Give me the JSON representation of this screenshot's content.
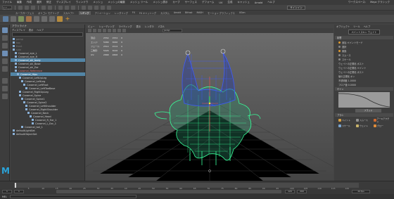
{
  "app": {
    "title": "Maya",
    "workspace_label": "ワークスペース:",
    "workspace_value": "Maya クラシック"
  },
  "menubar": [
    "ファイル",
    "編集",
    "作成",
    "選択",
    "修正",
    "ディスプレイ",
    "ウィンドウ",
    "メッシュ",
    "メッシュの編集",
    "メッシュ ツール",
    "メッシュ表示",
    "カーブ",
    "サーフェス",
    "デフォーム",
    "UV",
    "生成",
    "キャッシュ",
    "Arnold",
    "ヘルプ"
  ],
  "status": {
    "mode": "モデリング",
    "signin": "サインイン"
  },
  "shelf_tabs": [
    "カーブ/サーフェス",
    "ポリゴン モデリング",
    "スカルプト",
    "リギング",
    "アニメーション",
    "レンダリング",
    "FX",
    "FX キャッシング",
    "カスタム",
    "Arnold",
    "Bifrost",
    "MASH",
    "モーション グラフィックス",
    "XGen"
  ],
  "shelf_active": "リギング",
  "outliner": {
    "title": "アウトライナ",
    "menu": [
      "ディスプレイ",
      "表示",
      "ヘルプ"
    ],
    "items": [
      {
        "label": "persp",
        "state": "dim"
      },
      {
        "label": "top",
        "state": "dim"
      },
      {
        "label": "front",
        "state": "dim"
      },
      {
        "label": "side",
        "state": "dim"
      },
      {
        "label": "Caramel_eye_L",
        "state": "normal"
      },
      {
        "label": "Caramel_eye_R",
        "state": "normal"
      },
      {
        "label": "Caramel_skl_body",
        "state": "hl"
      },
      {
        "label": "Caramel_skl_Base",
        "state": "normal"
      },
      {
        "label": "Caramel_skl_Ear",
        "state": "normal"
      },
      {
        "label": "Caramel_Reference",
        "state": "red"
      },
      {
        "label": "Caramel_Hips",
        "state": "hl"
      },
      {
        "label": "Caramel_LeftUpLeg",
        "state": "normal"
      },
      {
        "label": "Caramel_LeftLeg",
        "state": "normal"
      },
      {
        "label": "Caramel_LeftFoot",
        "state": "normal"
      },
      {
        "label": "Caramel_LeftToeBase",
        "state": "normal"
      },
      {
        "label": "Caramel_RightUpLeg",
        "state": "normal"
      },
      {
        "label": "Caramel_Spine",
        "state": "normal"
      },
      {
        "label": "Caramel_Spine1",
        "state": "normal"
      },
      {
        "label": "Caramel_Spine2",
        "state": "normal"
      },
      {
        "label": "Caramel_LeftShoulder",
        "state": "normal"
      },
      {
        "label": "Caramel_RightShoulder",
        "state": "normal"
      },
      {
        "label": "Caramel_Neck",
        "state": "normal"
      },
      {
        "label": "Caramel_Head",
        "state": "normal"
      },
      {
        "label": "Caramel_R_Ear_1",
        "state": "normal"
      },
      {
        "label": "Caramel_L_Ear_1",
        "state": "normal"
      },
      {
        "label": "Caramel_tail_1",
        "state": "normal"
      },
      {
        "label": "defaultLightSet",
        "state": "normal"
      },
      {
        "label": "defaultObjectSet",
        "state": "normal"
      }
    ]
  },
  "viewport": {
    "menu": [
      "ビュー",
      "シェーディング",
      "ライティング",
      "表示",
      "レンダラ",
      "パネル"
    ],
    "camera": "persp",
    "hud": [
      [
        "頂点:",
        "2554",
        "1554",
        "0"
      ],
      [
        "エッジ:",
        "5066",
        "3066",
        "0"
      ],
      [
        "フェース:",
        "2514",
        "1514",
        "0"
      ],
      [
        "三角形:",
        "5026",
        "3026",
        "0"
      ],
      [
        "UV:",
        "2868",
        "2868",
        "0"
      ]
    ]
  },
  "attribute": {
    "tabs": [
      "オブジェクト",
      "ツール",
      "ヘルプ"
    ],
    "search": "ペイントスキン ウェイト",
    "lines": [
      {
        "label": "影響",
        "type": "section"
      },
      {
        "label": "追加 ペイントモード",
        "type": "radio",
        "on": true
      },
      {
        "label": "選択",
        "type": "radio",
        "on": false
      },
      {
        "label": "置換",
        "type": "radio",
        "on": true
      },
      {
        "label": "スムース",
        "type": "radio",
        "on": false
      },
      {
        "label": "スケール",
        "type": "radio",
        "on": false
      },
      {
        "label": "ウェイトの正規化 ポスト",
        "type": "text"
      },
      {
        "label": "ウェイトの正規化 ペイント",
        "type": "text"
      },
      {
        "label": "ウェイトの正規化 ポスト",
        "type": "text"
      },
      {
        "label": "値の正規化 オン",
        "type": "text"
      },
      {
        "label": "不透明度 1.0000",
        "type": "text"
      },
      {
        "label": "フロア値 0.0000",
        "type": "text"
      }
    ],
    "curve_label": "ゲイン",
    "curve_button": "フラッド",
    "brush_section": "ブラシ",
    "swatches": [
      {
        "label": "ペイント",
        "color": "#d8a040"
      },
      {
        "label": "スムース",
        "color": "#8f8f8f"
      },
      {
        "label": "アーキテクチャ",
        "color": "#d06a30"
      },
      {
        "label": "スケール",
        "color": "#7aa5d0"
      },
      {
        "label": "ウェイト",
        "color": "#c9b46a"
      },
      {
        "label": "グロー",
        "color": "#e08d3a"
      }
    ]
  },
  "timeline": {
    "ticks": [
      "5",
      "10",
      "15",
      "20",
      "25",
      "30",
      "35",
      "40",
      "45",
      "50",
      "55",
      "60",
      "65",
      "70",
      "75",
      "80",
      "85",
      "90",
      "95",
      "100",
      "105",
      "110",
      "115",
      "120"
    ]
  },
  "range": {
    "start": "1",
    "in": "1",
    "out": "120",
    "end": "200",
    "fps": "24 fps"
  },
  "cmdline": {
    "label": "MEL"
  }
}
